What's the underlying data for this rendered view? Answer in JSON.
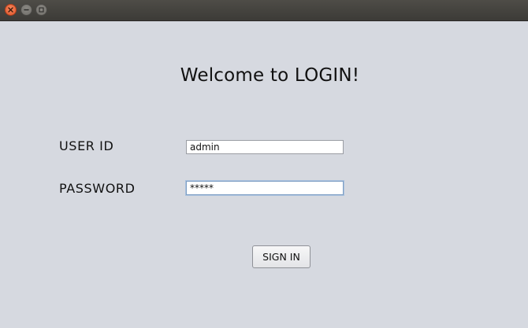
{
  "window": {
    "controls": {
      "close_icon": "close-icon",
      "minimize_icon": "minimize-icon",
      "maximize_icon": "maximize-icon"
    }
  },
  "login": {
    "heading": "Welcome to LOGIN!",
    "user_label": "USER ID",
    "user_value": "admin",
    "password_label": "PASSWORD",
    "password_value": "*****",
    "signin_label": "SIGN IN"
  },
  "colors": {
    "background": "#d6d9e0",
    "titlebar": "#3c3b37",
    "close_button": "#e0542a",
    "focus_border": "#7f9fc4"
  }
}
